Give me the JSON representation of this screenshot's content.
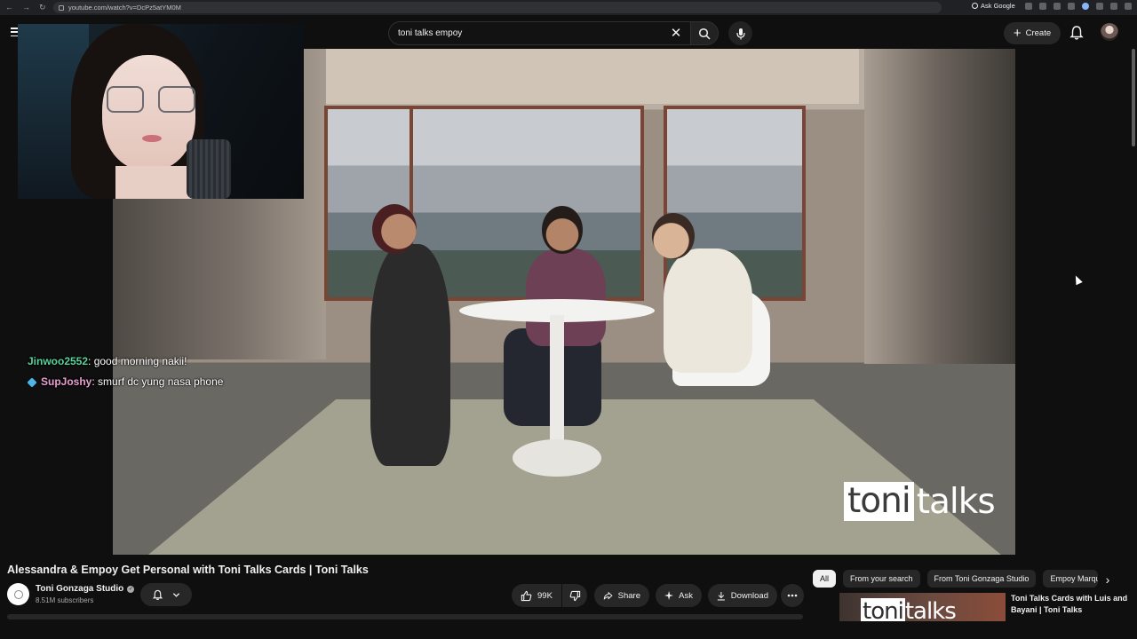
{
  "browser": {
    "url": "youtube.com/watch?v=DcPz5atYM0M",
    "ask_google": "Ask Google"
  },
  "header": {
    "search_query": "toni talks empoy",
    "create_label": "Create"
  },
  "video": {
    "brand_left": "toni",
    "brand_right": "talks"
  },
  "chat": [
    {
      "user": "Jinwoo2552",
      "message": " : good morning nakii!"
    },
    {
      "user": "SupJoshy",
      "message": " : smurf dc yung nasa phone"
    }
  ],
  "watch": {
    "title": "Alessandra & Empoy Get Personal with Toni Talks Cards | Toni Talks",
    "channel_name": "Toni Gonzaga Studio",
    "subscribers": "8.51M subscribers",
    "like_count": "99K",
    "share_label": "Share",
    "ask_label": "Ask",
    "download_label": "Download"
  },
  "chips": [
    "All",
    "From your search",
    "From Toni Gonzaga Studio",
    "Empoy Marque"
  ],
  "recommendation": {
    "thumb_left": "toni",
    "thumb_right": "talks",
    "title": "Toni Talks Cards with Luis and Bayani | Toni Talks"
  }
}
